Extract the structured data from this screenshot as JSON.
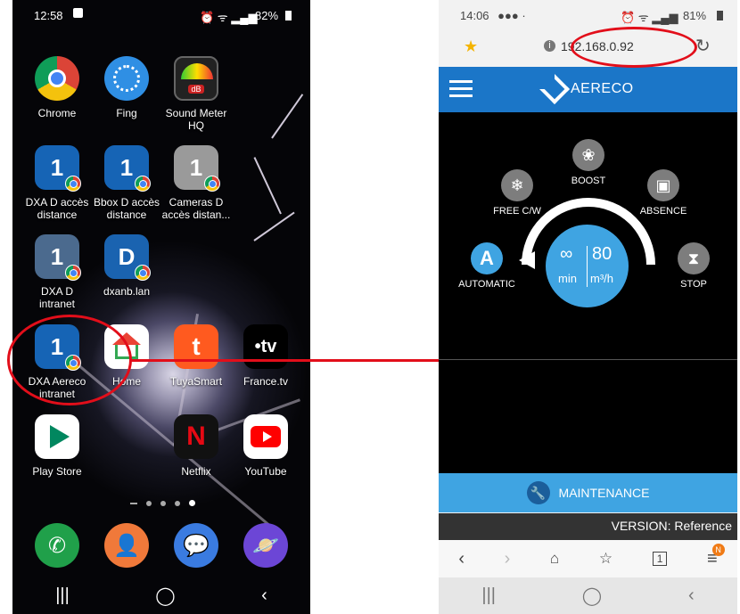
{
  "left": {
    "status": {
      "time": "12:58",
      "battery": "82%"
    },
    "apps": [
      {
        "label": "Chrome"
      },
      {
        "label": "Fing"
      },
      {
        "label": "Sound Meter\nHQ"
      },
      {
        "label": "DXA D accès\ndistance",
        "glyph": "1"
      },
      {
        "label": "Bbox D accès\ndistance",
        "glyph": "1"
      },
      {
        "label": "Cameras D\naccès distan...",
        "glyph": "1"
      },
      {
        "label": "DXA D\nintranet",
        "glyph": "1"
      },
      {
        "label": "dxanb.lan",
        "glyph": "D"
      },
      {
        "label": "DXA Aereco\nintranet",
        "glyph": "1"
      },
      {
        "label": "Home"
      },
      {
        "label": "TuyaSmart",
        "glyph": "t"
      },
      {
        "label": "France.tv",
        "glyph": "•tv"
      },
      {
        "label": "Play Store"
      },
      {
        "label": "Netflix",
        "glyph": "N"
      },
      {
        "label": "YouTube"
      }
    ],
    "sound_meter_badge": "dB"
  },
  "right": {
    "status": {
      "time": "14:06",
      "battery": "81%"
    },
    "url": "192.168.0.92",
    "brand": "AERECO",
    "modes": {
      "boost": "BOOST",
      "free": "FREE C/W",
      "absence": "ABSENCE",
      "automatic": "AUTOMATIC",
      "automatic_glyph": "A",
      "stop": "STOP"
    },
    "dial": {
      "left_top": "∞",
      "left_bottom": "min",
      "right_top": "80",
      "right_bottom": "m³/h"
    },
    "maintenance": "MAINTENANCE",
    "version": "VERSION: Reference",
    "tabs_count": "1",
    "notif_badge": "N"
  },
  "colors": {
    "accent": "#1b76c8",
    "maintenance": "#3fa4e2",
    "annotation": "#e20e1a"
  }
}
